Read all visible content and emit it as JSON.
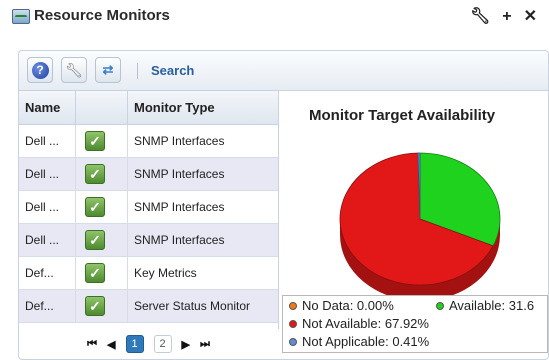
{
  "window": {
    "title": "Resource Monitors",
    "app_icon": "monitor-chart-icon",
    "tools": [
      "wrench-icon",
      "plus-icon",
      "close-icon"
    ]
  },
  "toolbar": {
    "help_icon": "help-icon",
    "wrench_icon": "wrench-icon",
    "config_icon": "configure-icon",
    "search_label": "Search"
  },
  "table": {
    "columns": [
      "Name",
      "",
      "Monitor Type"
    ],
    "rows": [
      {
        "name": "Dell ...",
        "status": "checked",
        "type": "SNMP Interfaces"
      },
      {
        "name": "Dell ...",
        "status": "checked",
        "type": "SNMP Interfaces"
      },
      {
        "name": "Dell ...",
        "status": "checked",
        "type": "SNMP Interfaces"
      },
      {
        "name": "Dell ...",
        "status": "checked",
        "type": "SNMP Interfaces"
      },
      {
        "name": "Def...",
        "status": "checked",
        "type": "Key Metrics"
      },
      {
        "name": "Def...",
        "status": "checked",
        "type": "Server Status Monitor"
      }
    ]
  },
  "pager": {
    "first": "⏮",
    "prev": "◀",
    "pages": [
      "1",
      "2"
    ],
    "current_page": "1",
    "next": "▶",
    "last": "⏭"
  },
  "chart_data": {
    "type": "pie",
    "title": "Monitor Target Availability",
    "categories": [
      "No Data",
      "Available",
      "Not Available",
      "Not Applicable"
    ],
    "values": [
      0.0,
      31.67,
      67.92,
      0.41
    ],
    "colors": [
      "#f07a1a",
      "#1ed21e",
      "#e21818",
      "#5b8fd0"
    ],
    "legend": [
      {
        "label": "No Data: 0.00%",
        "color": "#f07a1a"
      },
      {
        "label": "Available: 31.6",
        "color": "#1ed21e"
      },
      {
        "label": "Not Available: 67.92%",
        "color": "#e21818"
      },
      {
        "label": "Not Applicable: 0.41%",
        "color": "#5b8fd0"
      }
    ],
    "legend_position": "bottom"
  }
}
